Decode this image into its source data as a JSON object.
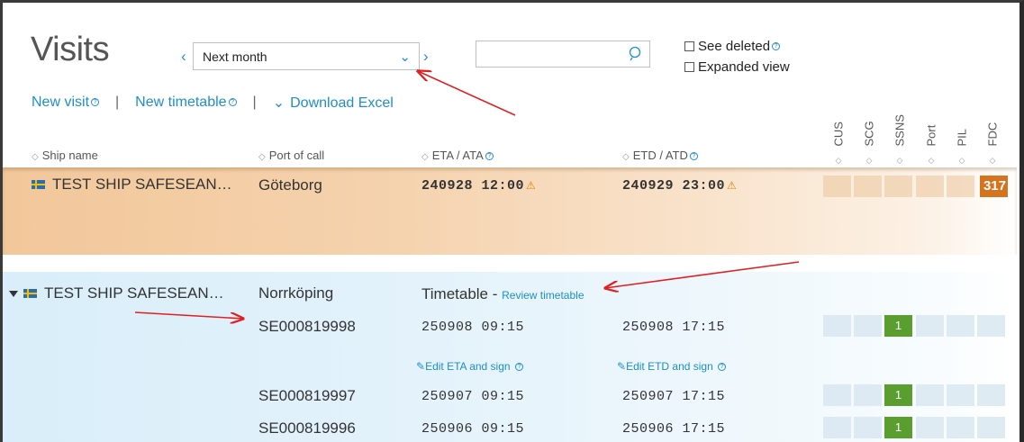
{
  "page": {
    "title": "Visits"
  },
  "filters": {
    "period_prev": "‹",
    "period_value": "Next month",
    "period_caret": "⌄",
    "period_next": "›",
    "search_placeholder": "",
    "see_deleted": "See deleted",
    "expanded_view": "Expanded view"
  },
  "actions": {
    "new_visit": "New visit",
    "separator": "|",
    "new_timetable": "New timetable",
    "download_excel": "Download Excel",
    "download_caret": "⌄"
  },
  "columns": {
    "ship_name": "Ship name",
    "port_of_call": "Port of call",
    "eta": "ETA / ATA",
    "etd": "ETD / ATD",
    "status": [
      "CUS",
      "SCG",
      "SSNS",
      "Port",
      "PIL",
      "FDC"
    ],
    "sort_glyph": "◇"
  },
  "visits": [
    {
      "ship": "TEST SHIP SAFESEAN…",
      "port": "Göteborg",
      "eta": "240928 12:00",
      "etd": "240929 23:00",
      "fdc_badge": "317",
      "color": "#f2c79a"
    },
    {
      "ship": "TEST SHIP SAFESEAN…",
      "port": "Norrköping",
      "timetable_label": "Timetable - ",
      "review_link": "Review timetable",
      "color": "#d9eefa",
      "items": [
        {
          "id": "SE000819998",
          "eta": "250908 09:15",
          "etd": "250908 17:15",
          "ssns": "1"
        },
        {
          "id": "SE000819997",
          "eta": "250907 09:15",
          "etd": "250907 17:15",
          "ssns": "1"
        },
        {
          "id": "SE000819996",
          "eta": "250906 09:15",
          "etd": "250906 17:15",
          "ssns": "1"
        }
      ],
      "edit_eta": "Edit ETA and sign",
      "edit_etd": "Edit ETD and sign"
    }
  ],
  "icons": {
    "warning": "⚠",
    "help": "?",
    "pencil": "✎"
  },
  "colors": {
    "accent": "#1f8ec9",
    "warning": "#f07c00",
    "badge": "#d6731f",
    "ok": "#5a9e2f",
    "annotation": "#e02020"
  }
}
